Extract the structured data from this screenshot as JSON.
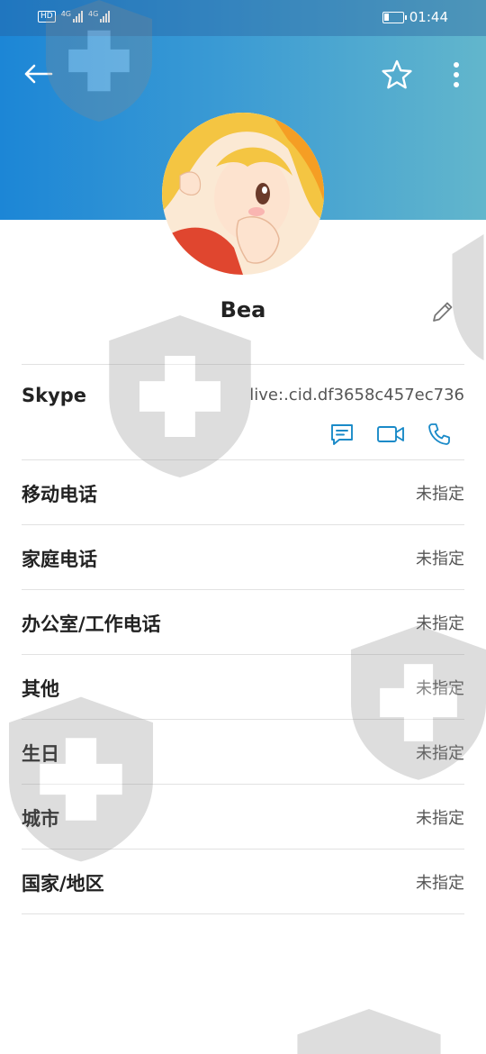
{
  "status_bar": {
    "hd_badge": "HD",
    "network_1": "4G",
    "network_2": "4G",
    "time": "01:44"
  },
  "profile": {
    "name": "Bea"
  },
  "skype": {
    "label": "Skype",
    "id": "live:.cid.df3658c457ec736"
  },
  "fields": [
    {
      "label": "移动电话",
      "value": "未指定"
    },
    {
      "label": "家庭电话",
      "value": "未指定"
    },
    {
      "label": "办公室/工作电话",
      "value": "未指定"
    },
    {
      "label": "其他",
      "value": "未指定"
    },
    {
      "label": "生日",
      "value": "未指定"
    },
    {
      "label": "城市",
      "value": "未指定"
    },
    {
      "label": "国家/地区",
      "value": "未指定"
    }
  ],
  "colors": {
    "accent": "#1a8ac8",
    "header_start": "#1c86d6",
    "header_end": "#62b6cc"
  },
  "icons": {
    "back": "arrow-left-icon",
    "favorite": "star-icon",
    "more": "more-vertical-icon",
    "edit": "pencil-icon",
    "message": "message-icon",
    "video": "video-call-icon",
    "call": "phone-icon"
  }
}
